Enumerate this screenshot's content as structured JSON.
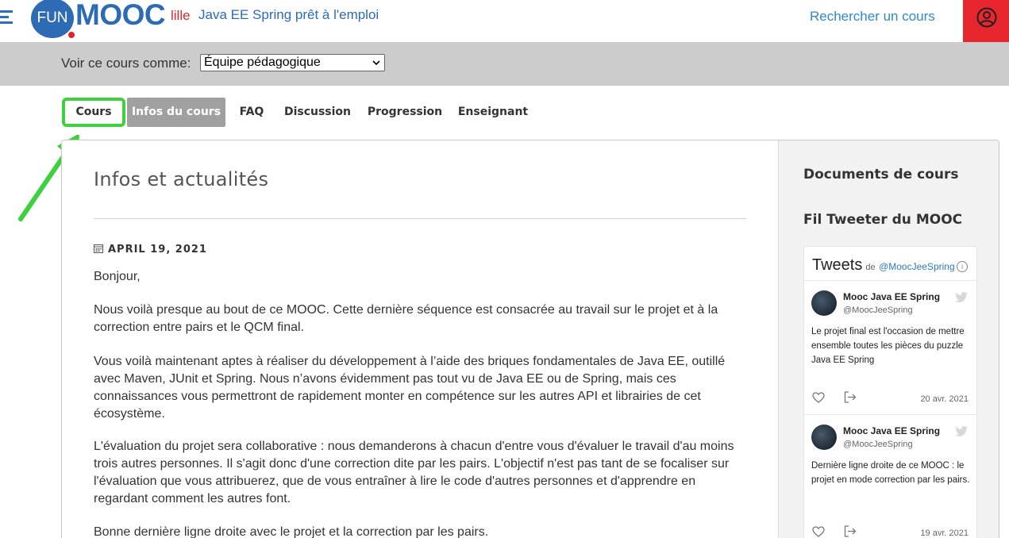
{
  "header": {
    "logo_fun": "FUN",
    "logo_mooc": "MOOC",
    "logo_lille": "lille",
    "course_title": "Java EE Spring prêt à l'emploi",
    "search_link": "Rechercher un cours"
  },
  "viewbar": {
    "label": "Voir ce cours comme:",
    "selected": "Équipe pédagogique"
  },
  "tabs": [
    {
      "label": "Cours"
    },
    {
      "label": "Infos du cours"
    },
    {
      "label": "FAQ"
    },
    {
      "label": "Discussion"
    },
    {
      "label": "Progression"
    },
    {
      "label": "Enseignant"
    }
  ],
  "main": {
    "title": "Infos et actualités",
    "date": "APRIL 19, 2021",
    "paragraphs": [
      "Bonjour,",
      "Nous voilà presque au bout de ce MOOC. Cette dernière séquence est consacrée au travail sur le projet et à la correction entre pairs et le QCM final.",
      "Vous voilà maintenant aptes à réaliser du développement à l’aide des briques fondamentales de Java EE, outillé avec Maven, JUnit et Spring. Nous n’avons évidemment pas tout vu de Java EE ou de Spring, mais ces connaissances vous permettront de rapidement monter en compétence sur les autres API et librairies de cet écosystème.",
      "L'évaluation du projet sera collaborative : nous demanderons à chacun d'entre vous d'évaluer le travail d'au moins trois autres personnes. Il s'agit donc d'une correction dite par les pairs. L'objectif n'est pas tant de se focaliser sur l'évaluation que vous attribuerez, que de vous entraîner à lire le code d'autres personnes et d'apprendre en regardant comment les autres font.",
      "Bonne dernière ligne droite avec le projet et la correction par les pairs."
    ]
  },
  "sidebar": {
    "documents_heading": "Documents de cours",
    "twitter_heading": "Fil Tweeter du MOOC",
    "widget": {
      "title": "Tweets",
      "by": "de",
      "handle": "@MoocJeeSpring",
      "info": "i"
    },
    "tweets": [
      {
        "name": "Mooc Java EE Spring",
        "handle": "@MoocJeeSpring",
        "text": "Le projet final est l'occasion de mettre ensemble toutes les pièces du puzzle Java EE Spring",
        "date": "20 avr. 2021"
      },
      {
        "name": "Mooc Java EE Spring",
        "handle": "@MoocJeeSpring",
        "text": "Dernière ligne droite de ce MOOC : le projet en mode correction par les pairs.",
        "date": "19 avr. 2021"
      }
    ]
  },
  "colors": {
    "brand_blue": "#2e6bb5",
    "brand_red": "#e0262d",
    "highlight_green": "#3dd13d",
    "active_tab": "#a0a0a0"
  }
}
